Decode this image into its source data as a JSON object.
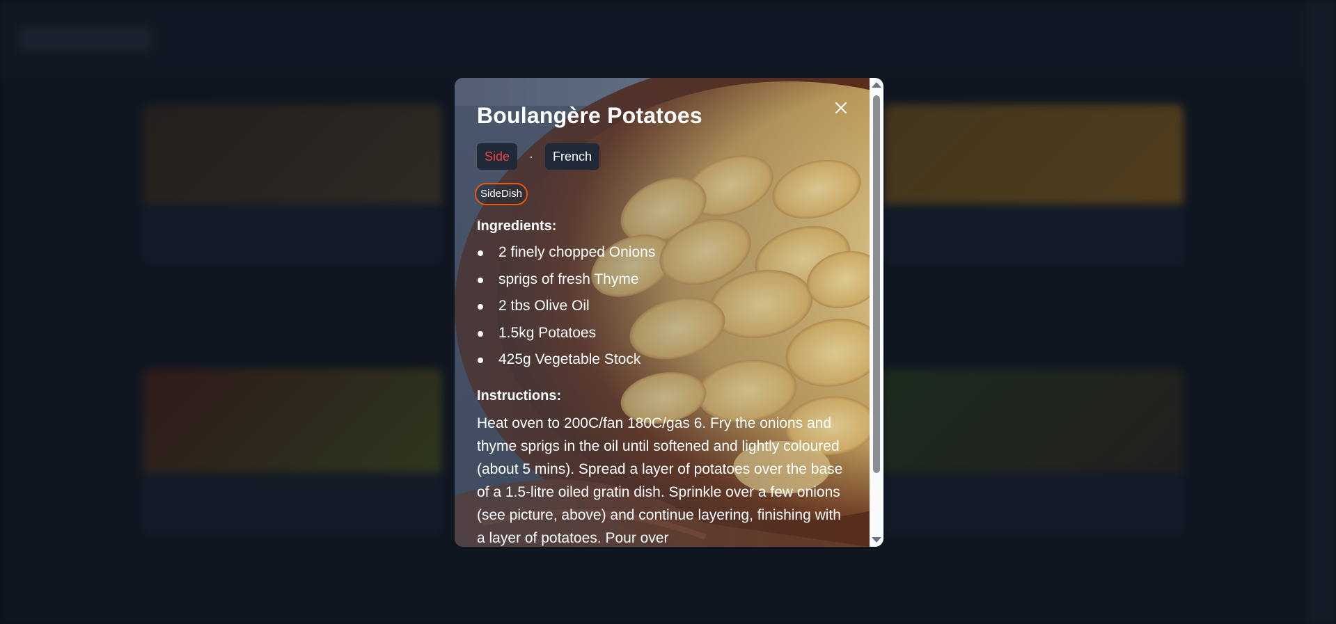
{
  "modal": {
    "title": "Boulangère Potatoes",
    "category": "Side",
    "separator": "·",
    "area": "French",
    "tags": [
      "SideDish"
    ],
    "ingredients_heading": "Ingredients:",
    "ingredients": [
      "2 finely chopped Onions",
      "sprigs of fresh Thyme",
      "2 tbs Olive Oil",
      "1.5kg Potatoes",
      "425g Vegetable Stock"
    ],
    "instructions_heading": "Instructions:",
    "instructions": "Heat oven to 200C/fan 180C/gas 6. Fry the onions and thyme sprigs in the oil until softened and lightly coloured (about 5 mins). Spread a layer of potatoes over the base of a 1.5-litre oiled gratin dish. Sprinkle over a few onions (see picture, above) and continue layering, finishing with a layer of potatoes. Pour over",
    "close_icon": "close-icon"
  },
  "colors": {
    "category_text": "#ef4444",
    "tag_border": "#ea580c",
    "pill_bg": "#1f2937",
    "overlay": "rgba(10,14,22,0.62)"
  }
}
